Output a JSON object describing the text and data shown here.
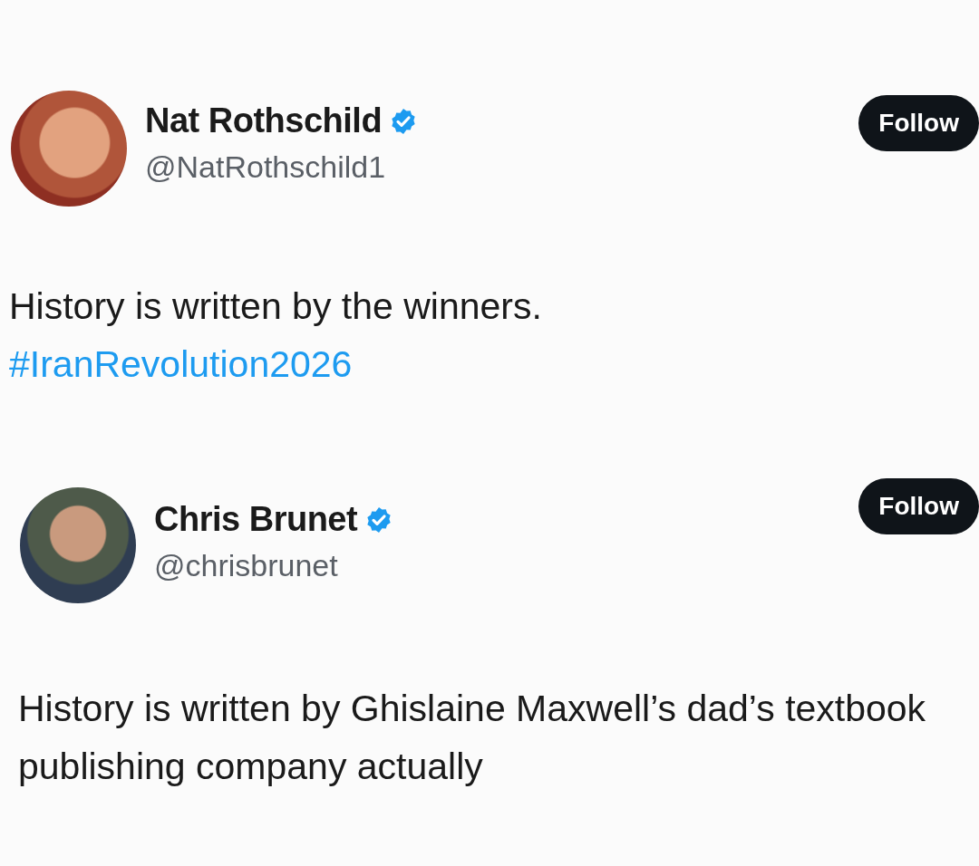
{
  "posts": [
    {
      "author": {
        "name": "Nat Rothschild",
        "handle": "@NatRothschild1",
        "verified": true
      },
      "follow_button": "Follow",
      "text": "History is written by the winners.",
      "hashtag": "#IranRevolution2026"
    },
    {
      "author": {
        "name": "Chris Brunet",
        "handle": "@chrisbrunet",
        "verified": true
      },
      "follow_button": "Follow",
      "text": "History is written by Ghislaine Maxwell’s dad’s textbook publishing company actually"
    }
  ]
}
